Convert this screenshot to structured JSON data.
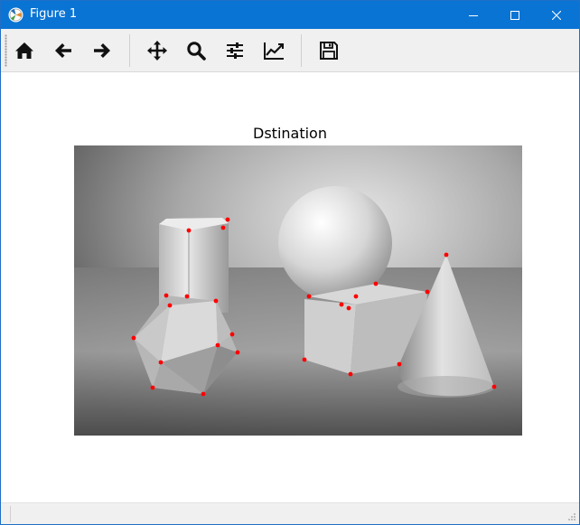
{
  "window": {
    "title": "Figure 1"
  },
  "toolbar": {
    "icons": [
      "home-icon",
      "arrow-left-icon",
      "arrow-right-icon",
      "move-icon",
      "zoom-icon",
      "sliders-icon",
      "line-chart-icon",
      "save-icon"
    ]
  },
  "figure": {
    "title": "Dstination"
  },
  "colors": {
    "titlebar": "#0a74d4",
    "toolbar": "#f0f0f0",
    "marker": "#ff0000"
  },
  "chart_data": {
    "type": "scatter",
    "title": "Dstination",
    "xlabel": "",
    "ylabel": "",
    "series": [
      {
        "x": [
          208,
          251,
          246,
          183,
          206,
          187,
          238,
          256,
          147,
          240,
          262,
          177,
          168,
          224,
          415,
          472,
          493,
          341,
          393,
          377,
          385,
          336,
          387,
          441,
          546
        ],
        "y": [
          254,
          242,
          251,
          326,
          327,
          337,
          332,
          369,
          373,
          381,
          389,
          400,
          428,
          435,
          313,
          322,
          281,
          327,
          327,
          336,
          340,
          397,
          413,
          402,
          427
        ]
      }
    ]
  }
}
